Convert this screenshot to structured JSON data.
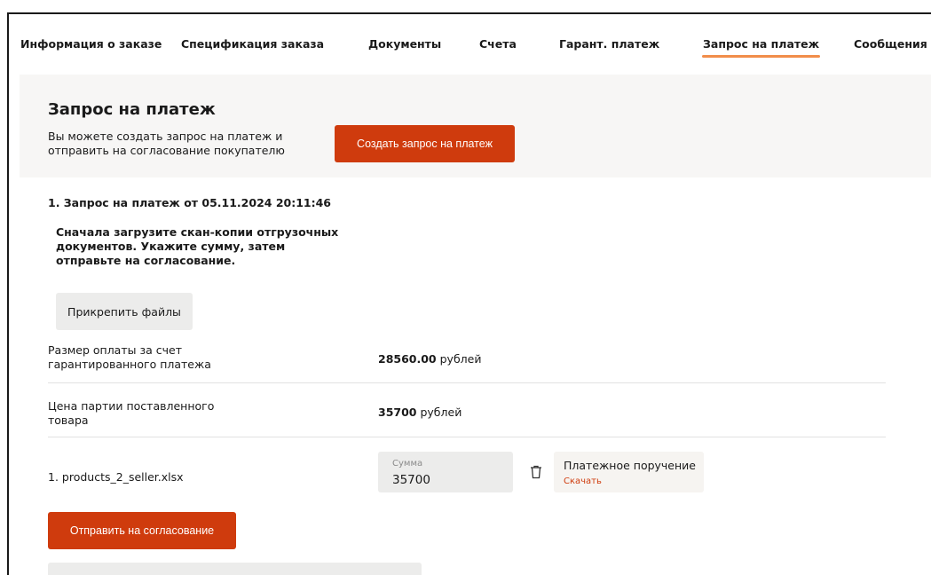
{
  "tabs": [
    {
      "label": "Информация о заказе"
    },
    {
      "label": "Спецификация заказа"
    },
    {
      "label": "Документы"
    },
    {
      "label": "Счета"
    },
    {
      "label": "Гарант. платеж"
    },
    {
      "label": "Запрос на платеж",
      "active": true
    },
    {
      "label": "Сообщения"
    }
  ],
  "header": {
    "title": "Запрос на платеж",
    "description": "Вы можете создать запрос на платеж и отправить на согласование покупателю",
    "create_button": "Создать запрос на платеж"
  },
  "request": {
    "title": "1. Запрос на платеж от 05.11.2024 20:11:46",
    "instructions": "Сначала загрузите скан-копии отгрузочных документов. Укажите сумму, затем отправьте на согласование.",
    "attach_button": "Прикрепить файлы",
    "rows": [
      {
        "label": "Размер оплаты за счет гарантированного платежа",
        "value": "28560.00",
        "unit": " рублей"
      },
      {
        "label": "Цена партии поставленного товара",
        "value": "35700",
        "unit": " рублей"
      }
    ],
    "file": {
      "name": "1. products_2_seller.xlsx",
      "sum_label": "Сумма",
      "sum_value": "35700",
      "doc_title": "Платежное поручение",
      "doc_link": "Скачать"
    },
    "send_button": "Отправить на согласование"
  },
  "colors": {
    "accent": "#cf3b0d",
    "tab_underline": "#f18d4a",
    "panel_bg": "#f7f6f5"
  }
}
